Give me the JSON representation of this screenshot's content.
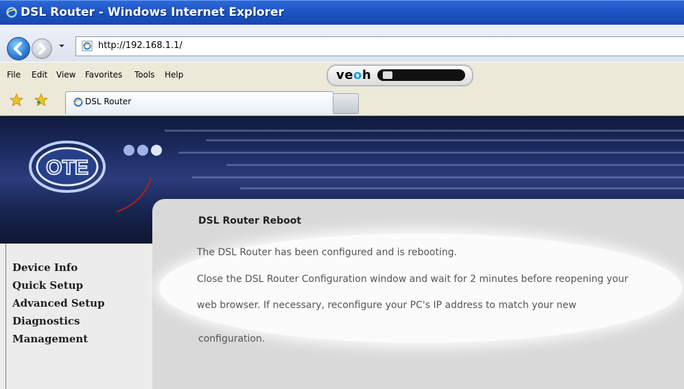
{
  "window": {
    "title": "DSL Router - Windows Internet Explorer"
  },
  "address_bar": {
    "url": "http://192.168.1.1/"
  },
  "menu": {
    "items": [
      "File",
      "Edit",
      "View",
      "Favorites",
      "Tools",
      "Help"
    ]
  },
  "toolbar": {
    "veoh_logo": "veoh"
  },
  "tabs": [
    {
      "label": "DSL Router"
    }
  ],
  "sidebar": {
    "items": [
      {
        "label": "Device Info"
      },
      {
        "label": "Quick Setup"
      },
      {
        "label": "Advanced Setup"
      },
      {
        "label": "Diagnostics"
      },
      {
        "label": "Management"
      }
    ]
  },
  "page": {
    "title": "DSL Router Reboot",
    "line1": "The DSL Router has been configured and is rebooting.",
    "line2": "Close the DSL Router Configuration window and wait for 2 minutes before reopening your",
    "line3": "web browser. If necessary, reconfigure your PC's IP address to match your new",
    "line4": "configuration."
  },
  "colors": {
    "titlebar": "#1d55c4",
    "sidebar_border": "#7a1020",
    "banner": "#1e2e66"
  }
}
